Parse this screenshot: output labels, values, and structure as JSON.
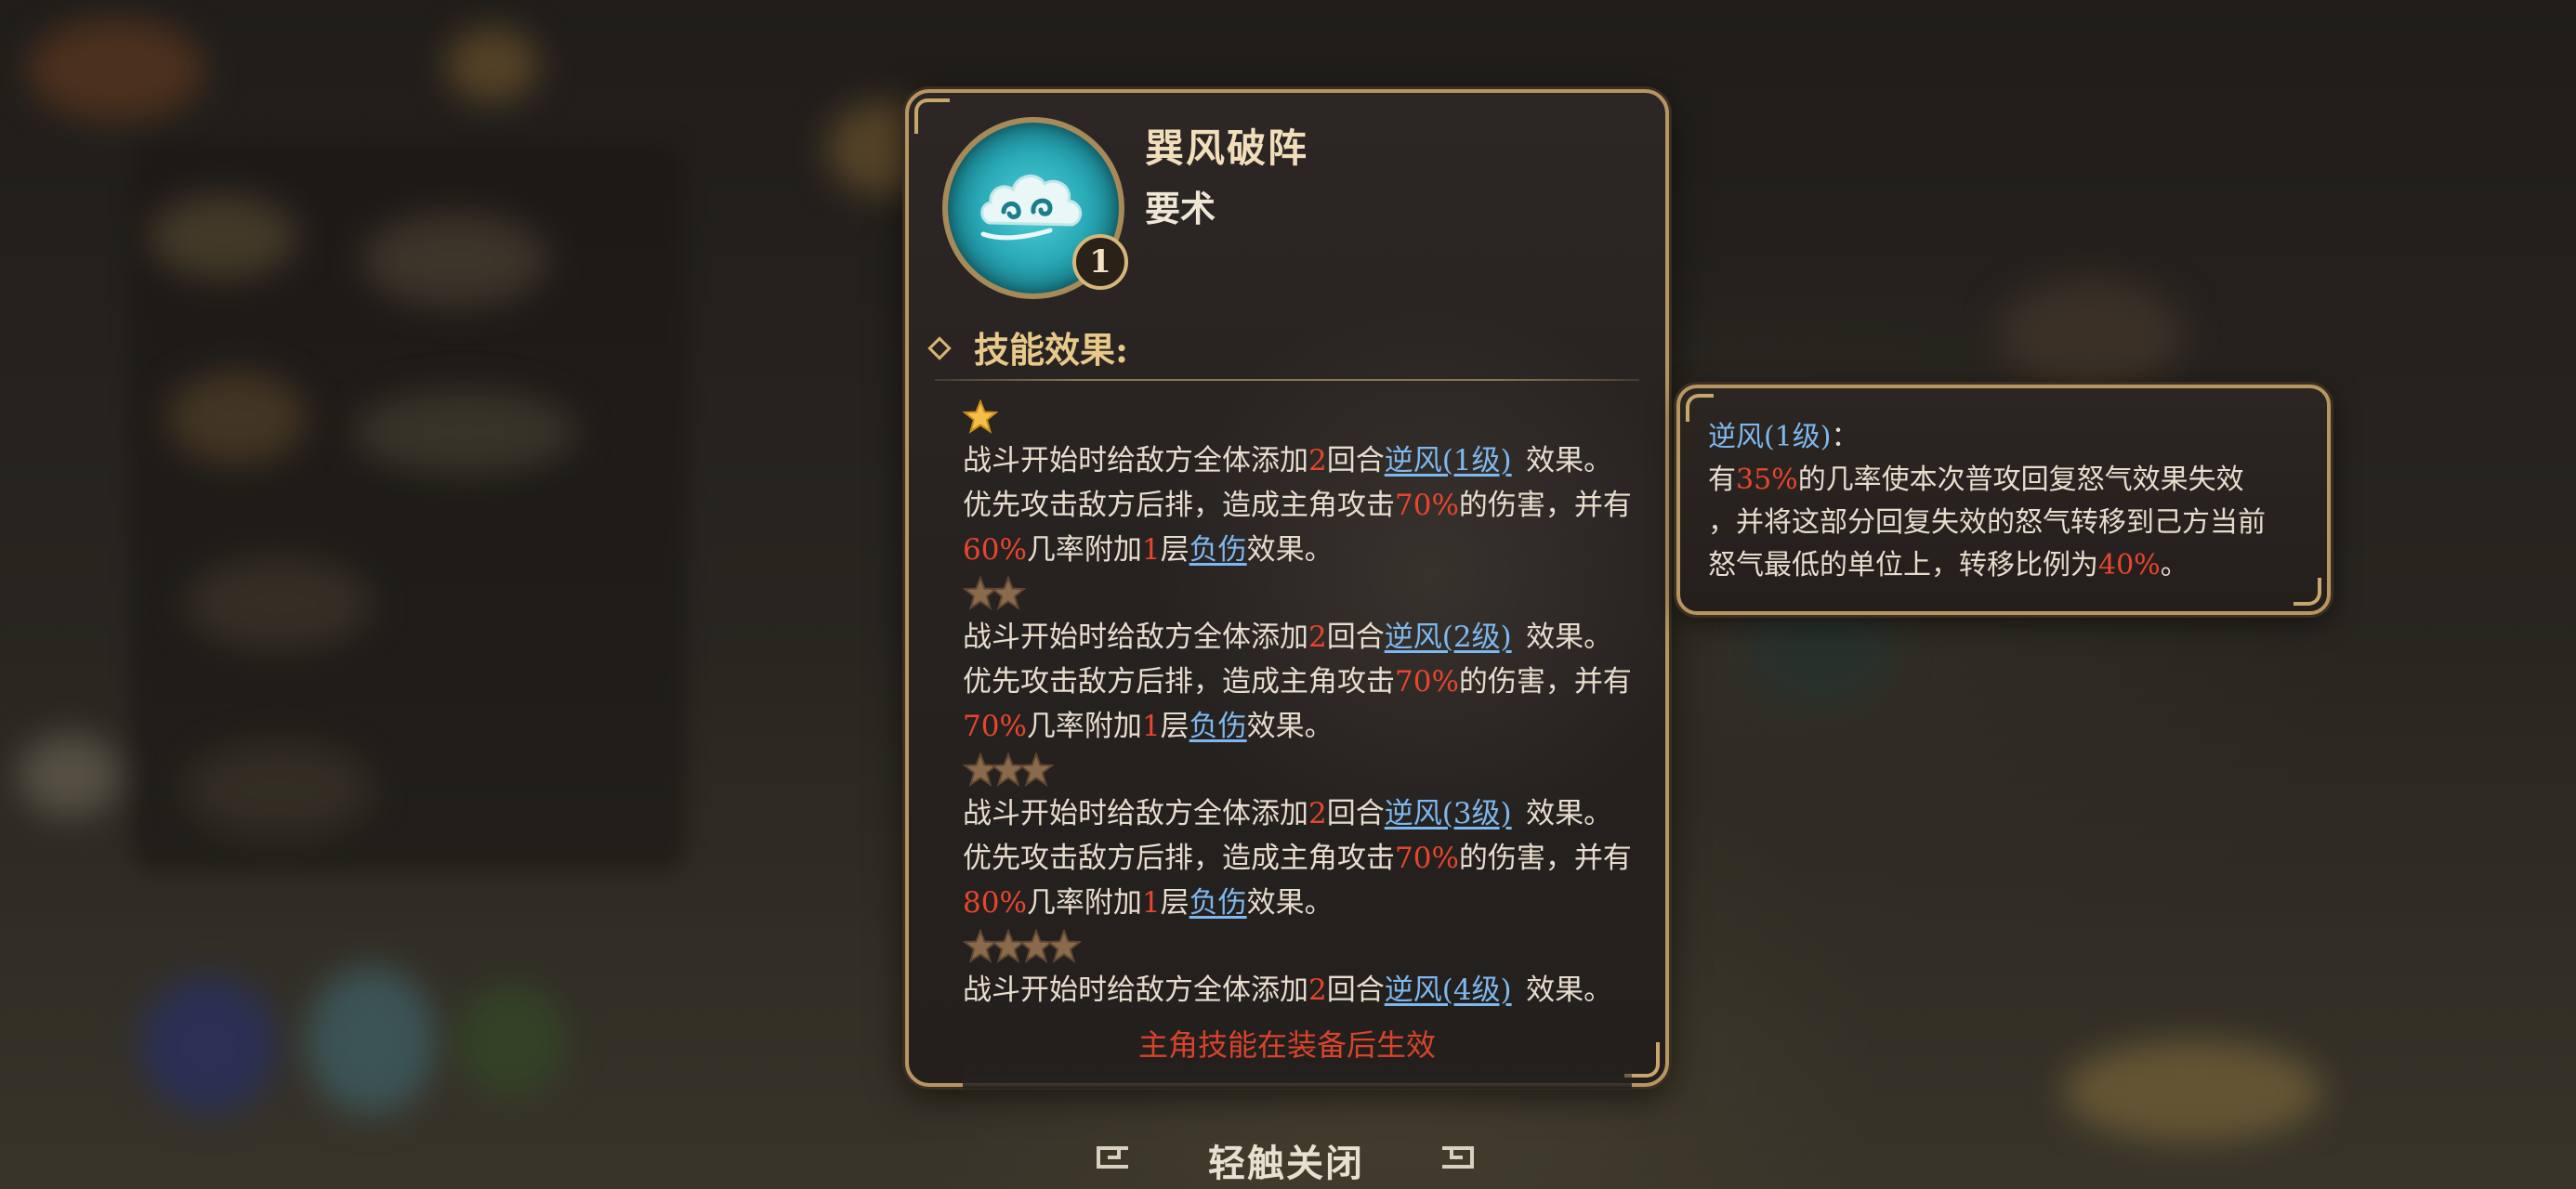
{
  "skill": {
    "name": "巽风破阵",
    "type": "要术",
    "level": "1",
    "icon": "wind-cloud-icon"
  },
  "effects_header": "技能效果:",
  "tiers": [
    {
      "stars": 1,
      "line1": {
        "a": "战斗开始时给敌方全体添加",
        "n": "2",
        "b": "回合",
        "link": "逆风(1级)",
        "c": "效果。"
      },
      "line2": {
        "a": "优先攻击敌方后排，造成主角攻击",
        "pct": "70%",
        "b": "的伤害，并有"
      },
      "line3": {
        "pct": "60%",
        "a": "几率附加",
        "n": "1",
        "b": "层",
        "link": "负伤",
        "c": "效果。"
      }
    },
    {
      "stars": 2,
      "line1": {
        "a": "战斗开始时给敌方全体添加",
        "n": "2",
        "b": "回合",
        "link": "逆风(2级)",
        "c": "效果。"
      },
      "line2": {
        "a": "优先攻击敌方后排，造成主角攻击",
        "pct": "70%",
        "b": "的伤害，并有"
      },
      "line3": {
        "pct": "70%",
        "a": "几率附加",
        "n": "1",
        "b": "层",
        "link": "负伤",
        "c": "效果。"
      }
    },
    {
      "stars": 3,
      "line1": {
        "a": "战斗开始时给敌方全体添加",
        "n": "2",
        "b": "回合",
        "link": "逆风(3级)",
        "c": "效果。"
      },
      "line2": {
        "a": "优先攻击敌方后排，造成主角攻击",
        "pct": "70%",
        "b": "的伤害，并有"
      },
      "line3": {
        "pct": "80%",
        "a": "几率附加",
        "n": "1",
        "b": "层",
        "link": "负伤",
        "c": "效果。"
      }
    },
    {
      "stars": 4,
      "line1": {
        "a": "战斗开始时给敌方全体添加",
        "n": "2",
        "b": "回合",
        "link": "逆风(4级)",
        "c": "效果。"
      }
    }
  ],
  "footer_note": "主角技能在装备后生效",
  "tooltip": {
    "title": "逆风(1级)",
    "colon": "：",
    "l1a": "有",
    "l1pct": "35%",
    "l1b": "的几率使本次普攻回复怒气效果失效",
    "l2": "，并将这部分回复失效的怒气转移到己方当前",
    "l3a": "怒气最低的单位上，转移比例为",
    "l3pct": "40%",
    "l3b": "。"
  },
  "close_hint": "轻触关闭",
  "colors": {
    "highlight_red": "#e8452e",
    "link_blue": "#7db8ef",
    "frame_gold": "#b89662",
    "active_star": "#f4c04a",
    "inactive_star": "#8a6a4a"
  }
}
